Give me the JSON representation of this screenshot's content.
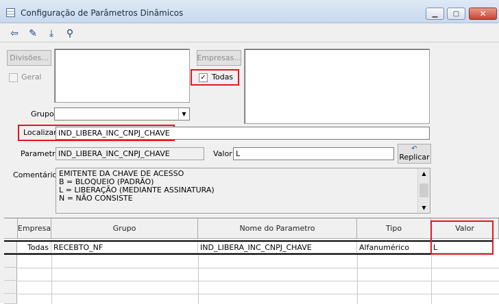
{
  "window": {
    "title": "Configuração de Parâmetros Dinâmicos"
  },
  "toolbar": {
    "buttons": [
      {
        "name": "exit-icon",
        "glyph": "⇦"
      },
      {
        "name": "eraser-icon",
        "glyph": "✎"
      },
      {
        "name": "save-download-icon",
        "glyph": "⤓"
      },
      {
        "name": "binoculars-icon",
        "glyph": "⚲"
      }
    ]
  },
  "divisoes": {
    "button_label": "Divisões...",
    "geral_label": "Geral",
    "geral_checked": false
  },
  "empresas": {
    "button_label": "Empresas...",
    "todas_label": "Todas",
    "todas_checked": true
  },
  "grupo": {
    "label": "Grupo",
    "value": ""
  },
  "localizar": {
    "label": "Localizar",
    "value": "IND_LIBERA_INC_CNPJ_CHAVE"
  },
  "parametro": {
    "label": "Parametro",
    "value": "IND_LIBERA_INC_CNPJ_CHAVE"
  },
  "valor_field": {
    "label": "Valor",
    "value": "L"
  },
  "replicar": {
    "label": "Replicar"
  },
  "comentarios": {
    "label": "Comentários",
    "lines": [
      "EMITENTE DA CHAVE DE ACESSO",
      "B = BLOQUEIO (PADRÃO)",
      "L = LIBERAÇÃO (MEDIANTE ASSINATURA)",
      "N = NÃO CONSISTE"
    ]
  },
  "grid": {
    "columns": [
      "Empresa",
      "Grupo",
      "Nome do Parametro",
      "Tipo",
      "Valor"
    ],
    "rows": [
      [
        "Todas",
        "RECEBTO_NF",
        "IND_LIBERA_INC_CNPJ_CHAVE",
        "Alfanumérico",
        "L"
      ]
    ]
  },
  "colors": {
    "highlight": "#e8141e",
    "titlebar": "#c9d9ee"
  }
}
